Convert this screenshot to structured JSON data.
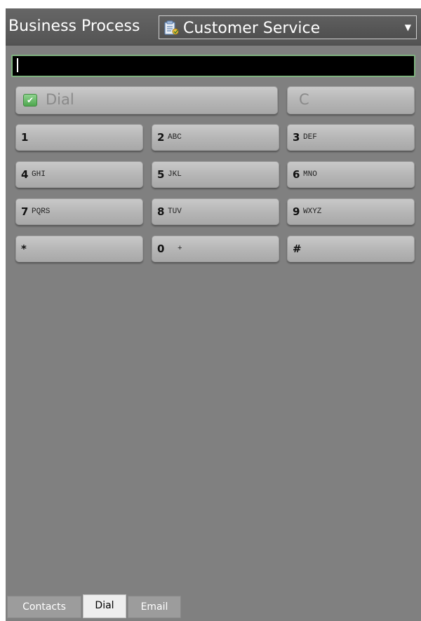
{
  "header": {
    "label": "Business Process",
    "process_value": "Customer Service",
    "process_icon": "clipboard-form-icon",
    "dropdown_icon": "triangle-down-icon"
  },
  "dialer": {
    "number_value": "",
    "dial_label": "Dial",
    "dial_icon": "phone-check-icon",
    "clear_label": "C"
  },
  "keypad": [
    {
      "digit": "1",
      "letters": ""
    },
    {
      "digit": "2",
      "letters": "ABC"
    },
    {
      "digit": "3",
      "letters": "DEF"
    },
    {
      "digit": "4",
      "letters": "GHI"
    },
    {
      "digit": "5",
      "letters": "JKL"
    },
    {
      "digit": "6",
      "letters": "MNO"
    },
    {
      "digit": "7",
      "letters": "PQRS"
    },
    {
      "digit": "8",
      "letters": "TUV"
    },
    {
      "digit": "9",
      "letters": "WXYZ"
    },
    {
      "digit": "*",
      "letters": ""
    },
    {
      "digit": "0",
      "letters": "+"
    },
    {
      "digit": "#",
      "letters": ""
    }
  ],
  "tabs": [
    {
      "label": "Contacts",
      "active": false
    },
    {
      "label": "Dial",
      "active": true
    },
    {
      "label": "Email",
      "active": false
    }
  ],
  "colors": {
    "background": "#808080",
    "header": "#5a5a5a",
    "display": "#000000",
    "display_border": "#7fb27f",
    "dial_icon": "#5cb85c"
  }
}
